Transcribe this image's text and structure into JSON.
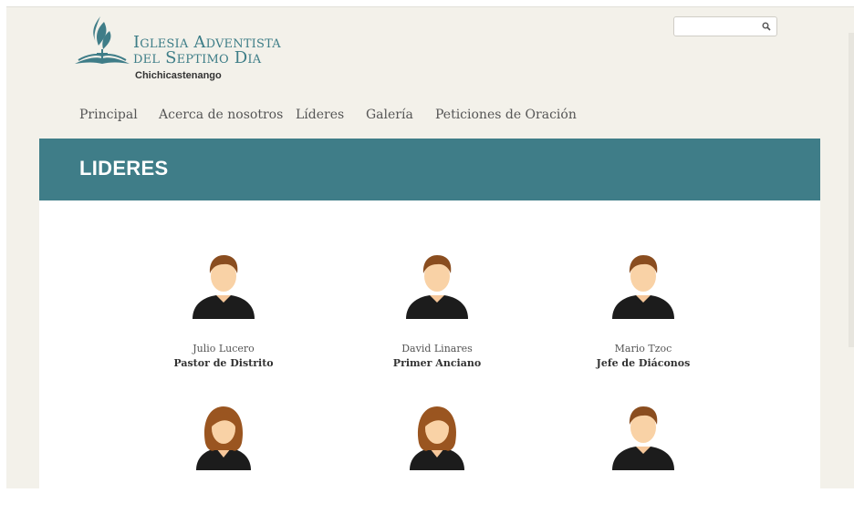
{
  "site": {
    "logo_line1": "Iglesia Adventista",
    "logo_line2": "del Septimo Dia",
    "logo_sub": "Chichicastenango",
    "brand_color": "#3f7d88"
  },
  "search": {
    "placeholder": "",
    "icon": "search-icon"
  },
  "nav": {
    "items": [
      {
        "label": "Principal"
      },
      {
        "label": "Acerca de nosotros"
      },
      {
        "label": "Líderes"
      },
      {
        "label": "Galería"
      },
      {
        "label": "Peticiones de Oración"
      }
    ]
  },
  "banner": {
    "title": "LIDERES"
  },
  "leaders": [
    {
      "name": "Julio Lucero",
      "role": "Pastor de Distrito",
      "avatar": "male-avatar-icon"
    },
    {
      "name": "David Linares",
      "role": "Primer Anciano",
      "avatar": "male-avatar-icon"
    },
    {
      "name": "Mario Tzoc",
      "role": "Jefe de Diáconos",
      "avatar": "male-avatar-icon"
    },
    {
      "name": "",
      "role": "",
      "avatar": "female-avatar-icon"
    },
    {
      "name": "",
      "role": "",
      "avatar": "female-avatar-icon"
    },
    {
      "name": "",
      "role": "",
      "avatar": "male-avatar-icon"
    }
  ]
}
